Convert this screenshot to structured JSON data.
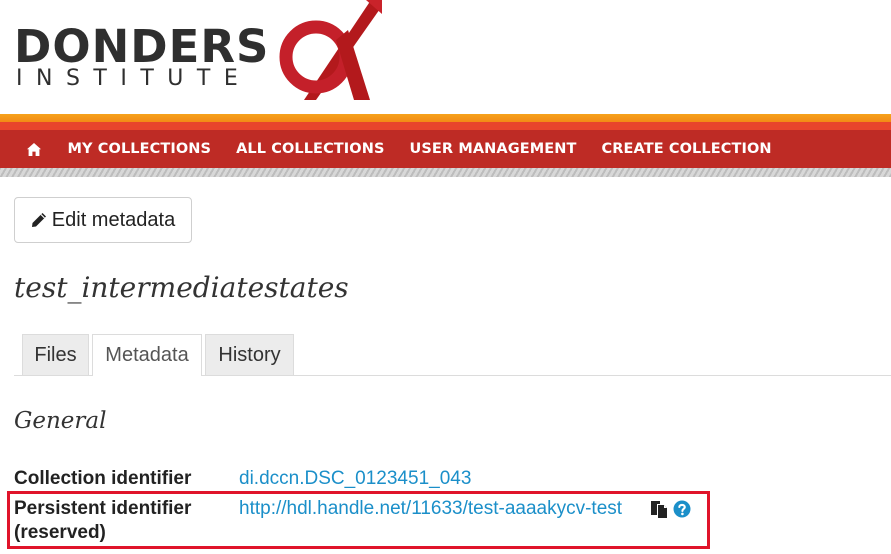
{
  "logo": {
    "word": "DONDERS",
    "sub": "INSTITUTE",
    "mark": "alpha-logo-icon"
  },
  "navbar": {
    "home_icon": "home-icon",
    "items": [
      {
        "label": "MY COLLECTIONS"
      },
      {
        "label": "ALL COLLECTIONS"
      },
      {
        "label": "USER MANAGEMENT"
      },
      {
        "label": "CREATE COLLECTION"
      }
    ]
  },
  "actions": {
    "edit_label": "Edit metadata",
    "edit_icon": "pencil-icon"
  },
  "collection": {
    "title": "test_intermediatestates"
  },
  "tabs": [
    {
      "label": "Files",
      "active": false
    },
    {
      "label": "Metadata",
      "active": true
    },
    {
      "label": "History",
      "active": false
    }
  ],
  "general": {
    "heading": "General",
    "collection_identifier": {
      "label": "Collection identifier",
      "value": "di.dccn.DSC_0123451_043"
    },
    "persistent_identifier": {
      "label_line1": "Persistent identifier",
      "label_line2": "(reserved)",
      "value": "http://hdl.handle.net/11633/test-aaaakycv-test",
      "copy_icon": "copy-icon",
      "help_icon": "help-icon"
    }
  },
  "colors": {
    "navbar": "#be2b25",
    "accent_orange": "#f6a21b",
    "link": "#1b8fc9",
    "highlight": "#e0142a"
  }
}
